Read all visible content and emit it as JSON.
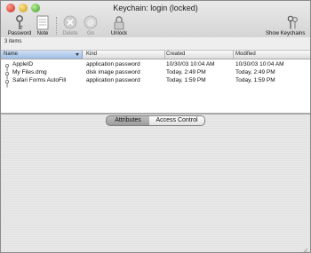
{
  "window": {
    "title": "Keychain: login (locked)"
  },
  "toolbar": {
    "password_label": "Password",
    "note_label": "Note",
    "delete_label": "Delete",
    "go_label": "Go",
    "unlock_label": "Unlock",
    "show_keychains_label": "Show Keychains"
  },
  "status": {
    "item_count": "3 items"
  },
  "table": {
    "headers": {
      "name": "Name",
      "kind": "Kind",
      "created": "Created",
      "modified": "Modified"
    },
    "rows": [
      {
        "name": "AppleID",
        "kind": "application password",
        "created": "10/30/03 10:04 AM",
        "modified": "10/30/03 10:04 AM"
      },
      {
        "name": "My Files.dmg",
        "kind": "disk image password",
        "created": "Today, 2:49 PM",
        "modified": "Today, 2:49 PM"
      },
      {
        "name": "Safari Forms AutoFill",
        "kind": "application password",
        "created": "Today, 1:59 PM",
        "modified": "Today, 1:59 PM"
      }
    ]
  },
  "tabs": {
    "attributes": "Attributes",
    "access_control": "Access Control"
  },
  "icons": {
    "password": "key-icon",
    "note": "note-icon",
    "delete": "delete-icon",
    "go": "go-icon",
    "unlock": "lock-icon",
    "show_keychains": "keys-icon",
    "row_item": "key-small-icon"
  }
}
